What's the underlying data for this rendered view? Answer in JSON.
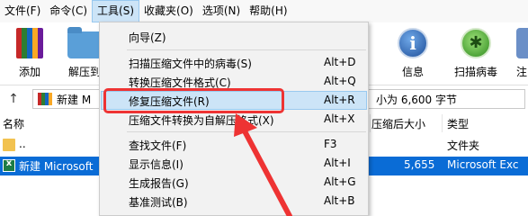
{
  "menubar": {
    "items": [
      "文件(F)",
      "命令(C)",
      "工具(S)",
      "收藏夹(O)",
      "选项(N)",
      "帮助(H)"
    ],
    "open_index": 2
  },
  "toolbar": {
    "buttons": [
      {
        "label": "添加",
        "icon": "archive-books-icon"
      },
      {
        "label": "解压到",
        "icon": "folder-extract-icon"
      },
      {
        "label": "信息",
        "icon": "info-icon"
      },
      {
        "label": "扫描病毒",
        "icon": "virus-scan-icon"
      },
      {
        "label": "注",
        "icon": "comment-icon"
      }
    ]
  },
  "address": {
    "up_icon": "↑",
    "path": "新建 M",
    "right_text": "小为 6,600 字节"
  },
  "filelist": {
    "columns": [
      "名称",
      "压缩后大小",
      "类型"
    ],
    "rows": [
      {
        "name": "..",
        "packed": "",
        "type": "文件夹"
      },
      {
        "name": "新建 Microsoft",
        "packed": "5,655",
        "type": "Microsoft Exc"
      }
    ]
  },
  "tools_menu": {
    "groups": [
      [
        {
          "label": "向导(Z)",
          "shortcut": ""
        }
      ],
      [
        {
          "label": "扫描压缩文件中的病毒(S)",
          "shortcut": "Alt+D"
        },
        {
          "label": "转换压缩文件格式(C)",
          "shortcut": "Alt+Q"
        },
        {
          "label": "修复压缩文件(R)",
          "shortcut": "Alt+R"
        },
        {
          "label": "压缩文件转换为自解压格式(X)",
          "shortcut": "Alt+X"
        }
      ],
      [
        {
          "label": "查找文件(F)",
          "shortcut": "F3"
        },
        {
          "label": "显示信息(I)",
          "shortcut": "Alt+I"
        },
        {
          "label": "生成报告(G)",
          "shortcut": "Alt+G"
        },
        {
          "label": "基准测试(B)",
          "shortcut": "Alt+B"
        }
      ]
    ],
    "highlighted": "修复压缩文件(R)"
  },
  "colors": {
    "selection": "#0a6cd6",
    "menu_highlight": "#cce4f7",
    "annotation": "#ee3333"
  }
}
